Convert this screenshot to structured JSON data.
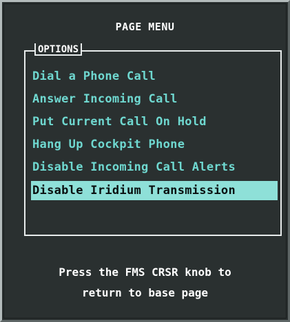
{
  "window": {
    "title": "PAGE MENU"
  },
  "options": {
    "legend": "OPTIONS",
    "items": [
      {
        "label": "Dial a Phone Call"
      },
      {
        "label": "Answer Incoming Call"
      },
      {
        "label": "Put Current Call On Hold"
      },
      {
        "label": "Hang Up Cockpit Phone"
      },
      {
        "label": "Disable Incoming Call Alerts"
      },
      {
        "label": "Disable Iridium Transmission"
      }
    ],
    "selected_index": 5
  },
  "footer": {
    "line1": "Press the FMS CRSR knob to",
    "line2": "return to base page"
  },
  "colors": {
    "background": "#2a3030",
    "item_text": "#6fd8d0",
    "selected_highlight": "#8ee0d8",
    "heading_text": "#ffffff"
  }
}
